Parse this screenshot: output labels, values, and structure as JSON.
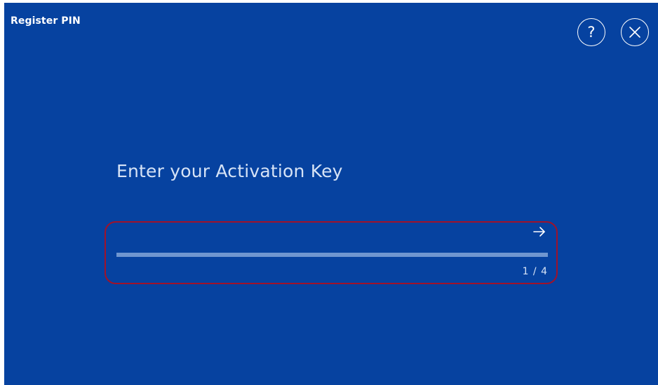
{
  "window": {
    "title": "Register PIN"
  },
  "header_buttons": {
    "help_glyph": "?",
    "help_icon": "question-icon",
    "close_icon": "close-x-icon"
  },
  "main": {
    "heading": "Enter your Activation Key",
    "input_value": "",
    "input_placeholder": "",
    "submit_icon": "arrow-right-icon",
    "step": {
      "current": 1,
      "total": 4,
      "label": "1 / 4"
    }
  },
  "colors": {
    "background": "#0642a0",
    "highlight_border": "#a0122a",
    "progress_track": "#6f96d0",
    "text": "#ffffff"
  }
}
